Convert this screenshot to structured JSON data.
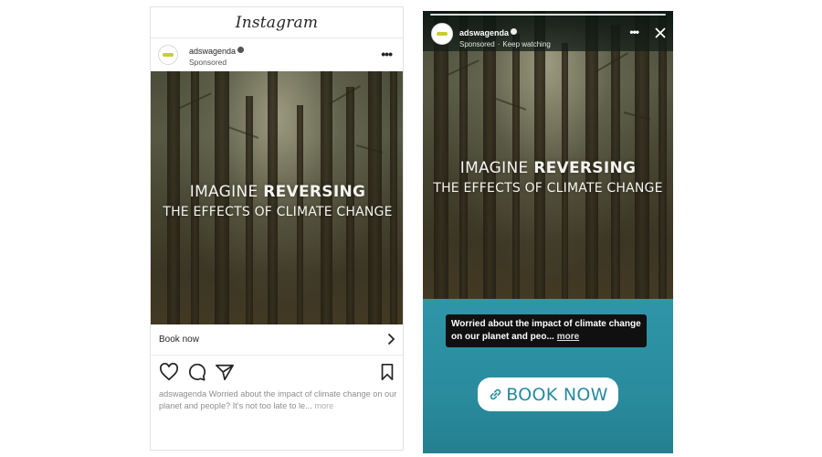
{
  "feed": {
    "app_title": "Instagram",
    "account_name": "adswagenda",
    "sponsored_label": "Sponsored",
    "menu_icon": "more-dots-icon",
    "image_text_prefix": "IMAGINE ",
    "image_text_bold": "REVERSING",
    "image_text_line2": "THE EFFECTS OF CLIMATE CHANGE",
    "cta_label": "Book now",
    "action_icons": [
      "heart-icon",
      "comment-icon",
      "share-icon",
      "bookmark-icon"
    ],
    "caption_username": "adswagenda",
    "caption_text": " Worried about the impact of climate change on our planet and people? It's not too late to le...",
    "caption_more": " more"
  },
  "story": {
    "account_name": "adswagenda",
    "sponsored_label": "Sponsored",
    "separator": "·",
    "keep_watching": "Keep watching",
    "image_text_prefix": "IMAGINE ",
    "image_text_bold": "REVERSING",
    "image_text_line2": "THE EFFECTS OF CLIMATE CHANGE",
    "caption_text": "Worried about the impact of climate change on our planet and peo...",
    "caption_more": "more",
    "cta_label": "BOOK NOW",
    "colors": {
      "accent": "#2a8ea0",
      "cta_text": "#268a9c"
    }
  }
}
